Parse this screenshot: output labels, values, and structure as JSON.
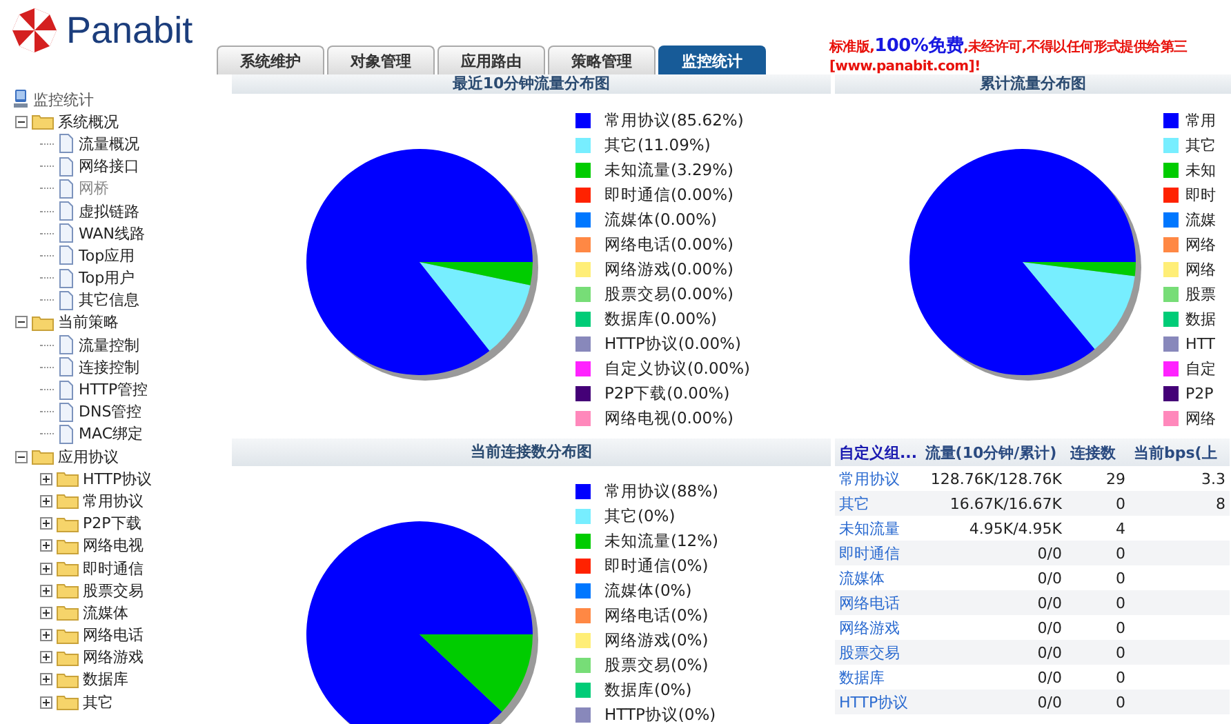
{
  "logo": {
    "text": "Panabit"
  },
  "tabs": [
    {
      "label": "系统维护",
      "selected": false
    },
    {
      "label": "对象管理",
      "selected": false
    },
    {
      "label": "应用路由",
      "selected": false
    },
    {
      "label": "策略管理",
      "selected": false
    },
    {
      "label": "监控统计",
      "selected": true
    }
  ],
  "notice": {
    "parts": [
      {
        "text": "标准版,",
        "kind": "normal"
      },
      {
        "text": "100%免费",
        "kind": "emphasis"
      },
      {
        "text": ",未经许可,不得以任何形式提供给第三",
        "kind": "normal"
      }
    ],
    "second_line": "[www.panabit.com]!"
  },
  "sidebar": {
    "root": "监控统计",
    "groups": [
      {
        "label": "系统概况",
        "expanded": true,
        "children": [
          {
            "label": "流量概况",
            "kind": "page",
            "disabled": false
          },
          {
            "label": "网络接口",
            "kind": "page",
            "disabled": false
          },
          {
            "label": "网桥",
            "kind": "page",
            "disabled": true
          },
          {
            "label": "虚拟链路",
            "kind": "page",
            "disabled": false
          },
          {
            "label": "WAN线路",
            "kind": "page",
            "disabled": false
          },
          {
            "label": "Top应用",
            "kind": "page",
            "disabled": false
          },
          {
            "label": "Top用户",
            "kind": "page",
            "disabled": false
          },
          {
            "label": "其它信息",
            "kind": "page",
            "disabled": false
          }
        ]
      },
      {
        "label": "当前策略",
        "expanded": true,
        "children": [
          {
            "label": "流量控制",
            "kind": "page",
            "disabled": false
          },
          {
            "label": "连接控制",
            "kind": "page",
            "disabled": false
          },
          {
            "label": "HTTP管控",
            "kind": "page",
            "disabled": false
          },
          {
            "label": "DNS管控",
            "kind": "page",
            "disabled": false
          },
          {
            "label": "MAC绑定",
            "kind": "page",
            "disabled": false
          }
        ]
      },
      {
        "label": "应用协议",
        "expanded": true,
        "children": [
          {
            "label": "HTTP协议",
            "kind": "folder",
            "expanded": false
          },
          {
            "label": "常用协议",
            "kind": "folder",
            "expanded": false
          },
          {
            "label": "P2P下载",
            "kind": "folder",
            "expanded": false
          },
          {
            "label": "网络电视",
            "kind": "folder",
            "expanded": false
          },
          {
            "label": "即时通信",
            "kind": "folder",
            "expanded": false
          },
          {
            "label": "股票交易",
            "kind": "folder",
            "expanded": false
          },
          {
            "label": "流媒体",
            "kind": "folder",
            "expanded": false
          },
          {
            "label": "网络电话",
            "kind": "folder",
            "expanded": false
          },
          {
            "label": "网络游戏",
            "kind": "folder",
            "expanded": false
          },
          {
            "label": "数据库",
            "kind": "folder",
            "expanded": false
          },
          {
            "label": "其它",
            "kind": "folder",
            "expanded": false
          }
        ]
      }
    ]
  },
  "recent_panel": {
    "title": "最近10分钟流量分布图",
    "chart_data": {
      "type": "pie",
      "categories": [
        "常用协议(85.62%)",
        "其它(11.09%)",
        "未知流量(3.29%)",
        "即时通信(0.00%)",
        "流媒体(0.00%)",
        "网络电话(0.00%)",
        "网络游戏(0.00%)",
        "股票交易(0.00%)",
        "数据库(0.00%)",
        "HTTP协议(0.00%)",
        "自定义协议(0.00%)",
        "P2P下载(0.00%)",
        "网络电视(0.00%)"
      ],
      "values": [
        85.62,
        11.09,
        3.29,
        0,
        0,
        0,
        0,
        0,
        0,
        0,
        0,
        0,
        0
      ],
      "colors": [
        "#0000ff",
        "#77eeff",
        "#00cc00",
        "#ff2200",
        "#0077ff",
        "#ff8844",
        "#ffee77",
        "#77dd77",
        "#00cc77",
        "#8888bb",
        "#ff22ff",
        "#440077",
        "#ff88bb"
      ]
    }
  },
  "total_panel": {
    "title": "累计流量分布图",
    "legend": [
      {
        "label": "常用",
        "color": "#0000ff"
      },
      {
        "label": "其它",
        "color": "#77eeff"
      },
      {
        "label": "未知",
        "color": "#00cc00"
      },
      {
        "label": "即时",
        "color": "#ff2200"
      },
      {
        "label": "流媒",
        "color": "#0077ff"
      },
      {
        "label": "网络",
        "color": "#ff8844"
      },
      {
        "label": "网络",
        "color": "#ffee77"
      },
      {
        "label": "股票",
        "color": "#77dd77"
      },
      {
        "label": "数据",
        "color": "#00cc77"
      },
      {
        "label": "HTT",
        "color": "#8888bb"
      },
      {
        "label": "自定",
        "color": "#ff22ff"
      },
      {
        "label": "P2P",
        "color": "#440077"
      },
      {
        "label": "网络",
        "color": "#ff88bb"
      }
    ]
  },
  "connections_panel": {
    "title": "当前连接数分布图",
    "chart_data": {
      "type": "pie",
      "categories": [
        "常用协议(88%)",
        "其它(0%)",
        "未知流量(12%)",
        "即时通信(0%)",
        "流媒体(0%)",
        "网络电话(0%)",
        "网络游戏(0%)",
        "股票交易(0%)",
        "数据库(0%)",
        "HTTP协议(0%)"
      ],
      "values": [
        88,
        0,
        12,
        0,
        0,
        0,
        0,
        0,
        0,
        0
      ],
      "colors": [
        "#0000ff",
        "#77eeff",
        "#00cc00",
        "#ff2200",
        "#0077ff",
        "#ff8844",
        "#ffee77",
        "#77dd77",
        "#00cc77",
        "#8888bb"
      ]
    }
  },
  "table": {
    "columns": [
      "自定义组...",
      "流量(10分钟/累计)",
      "连接数",
      "当前bps(上"
    ],
    "rows": [
      {
        "name": "常用协议",
        "flow": "128.76K/128.76K",
        "connections": "29",
        "bps": "3.3"
      },
      {
        "name": "其它",
        "flow": "16.67K/16.67K",
        "connections": "0",
        "bps": "8"
      },
      {
        "name": "未知流量",
        "flow": "4.95K/4.95K",
        "connections": "4"
      },
      {
        "name": "即时通信",
        "flow": "0/0",
        "connections": "0"
      },
      {
        "name": "流媒体",
        "flow": "0/0",
        "connections": "0"
      },
      {
        "name": "网络电话",
        "flow": "0/0",
        "connections": "0"
      },
      {
        "name": "网络游戏",
        "flow": "0/0",
        "connections": "0"
      },
      {
        "name": "股票交易",
        "flow": "0/0",
        "connections": "0"
      },
      {
        "name": "数据库",
        "flow": "0/0",
        "connections": "0"
      },
      {
        "name": "HTTP协议",
        "flow": "0/0",
        "connections": "0"
      }
    ]
  }
}
